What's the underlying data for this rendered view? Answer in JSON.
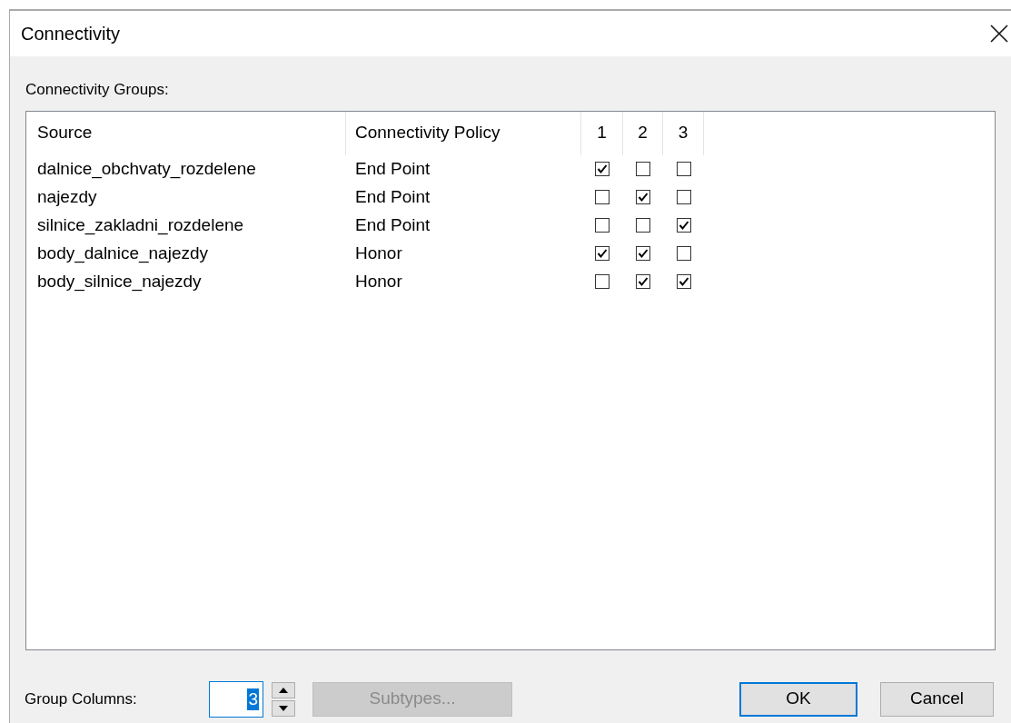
{
  "window": {
    "title": "Connectivity"
  },
  "groups_label": "Connectivity Groups:",
  "table": {
    "columns": [
      "Source",
      "Connectivity Policy",
      "1",
      "2",
      "3"
    ],
    "rows": [
      {
        "source": "dalnice_obchvaty_rozdelene",
        "policy": "End Point",
        "groups": [
          {
            "checked": true
          },
          {
            "checked": false
          },
          {
            "checked": false
          }
        ]
      },
      {
        "source": "najezdy",
        "policy": "End Point",
        "groups": [
          {
            "checked": false
          },
          {
            "checked": true
          },
          {
            "checked": false
          }
        ]
      },
      {
        "source": "silnice_zakladni_rozdelene",
        "policy": "End Point",
        "groups": [
          {
            "checked": false
          },
          {
            "checked": false
          },
          {
            "checked": true
          }
        ]
      },
      {
        "source": "body_dalnice_najezdy",
        "policy": "Honor",
        "groups": [
          {
            "checked": true
          },
          {
            "checked": true
          },
          {
            "checked": false
          }
        ]
      },
      {
        "source": "body_silnice_najezdy",
        "policy": "Honor",
        "groups": [
          {
            "checked": false
          },
          {
            "checked": true
          },
          {
            "checked": true
          }
        ]
      }
    ]
  },
  "group_columns": {
    "label": "Group Columns:",
    "value": "3"
  },
  "buttons": [
    {
      "label": "Subtypes...",
      "disabled": true,
      "default": false
    },
    {
      "label": "OK",
      "disabled": false,
      "default": true
    },
    {
      "label": "Cancel",
      "disabled": false,
      "default": false
    }
  ]
}
